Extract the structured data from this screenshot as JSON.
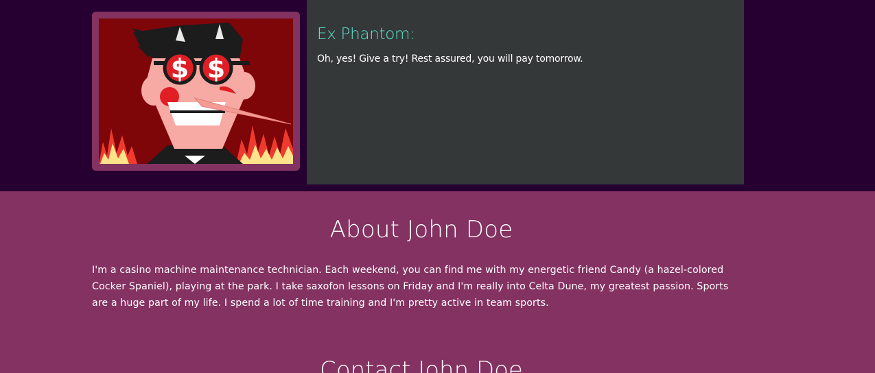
{
  "card": {
    "title": "Ex Phantom:",
    "text": "Oh, yes! Give a try! Rest assured, you will pay tomorrow.",
    "image_icon": "greedy-cartoon-character-with-dollar-glasses-in-flames"
  },
  "about": {
    "heading": "About John Doe",
    "text": "I'm a casino machine maintenance technician. Each weekend, you can find me with my energetic friend Candy (a hazel-colored Cocker Spaniel), playing at the park. I take saxofon lessons on Friday and I'm really into Celta Dune, my greatest passion. Sports are a huge part of my life. I spend a lot of time training and I'm pretty active in team sports."
  },
  "contact": {
    "heading": "Contact John Doe"
  },
  "colors": {
    "top_band": "#270032",
    "page_bg": "#843262",
    "card_bg": "#343839",
    "title_accent": "#5ce6cf"
  }
}
